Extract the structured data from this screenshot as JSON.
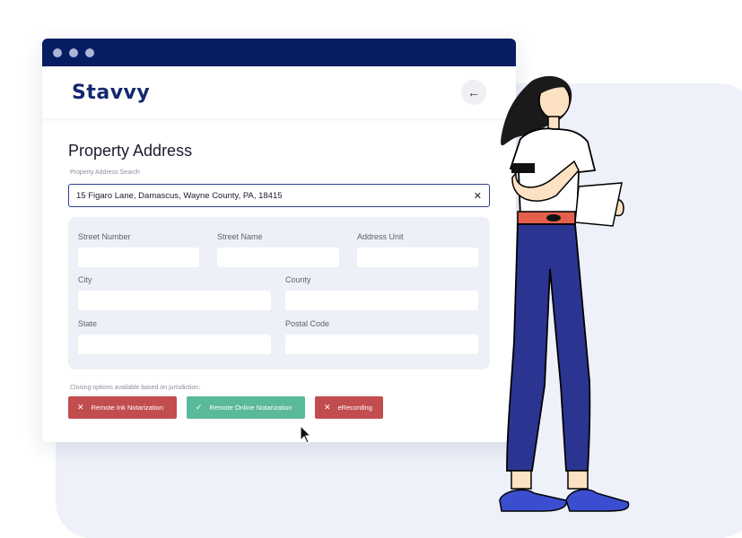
{
  "app": {
    "logo": "Stavvy"
  },
  "header": {
    "back_icon": "arrow-left-icon"
  },
  "page": {
    "title": "Property Address",
    "search_label": "Property Address Search",
    "search_value": "15 Figaro Lane, Damascus, Wayne County, PA, 18415",
    "clear_icon": "close-icon"
  },
  "form": {
    "street_number": "Street Number",
    "street_name": "Street Name",
    "address_unit": "Address Unit",
    "city": "City",
    "county": "County",
    "state": "State",
    "postal_code": "Postal Code"
  },
  "closing": {
    "label": "Closing options available based on jurisdiction:",
    "options": [
      {
        "label": "Remote Ink Notarization",
        "icon": "close-icon",
        "color": "#c24d4f"
      },
      {
        "label": "Remote Online Notarization",
        "icon": "check-icon",
        "color": "#5bb99b"
      },
      {
        "label": "eRecording",
        "icon": "close-icon",
        "color": "#c24d4f"
      }
    ]
  },
  "colors": {
    "titlebar": "#061c63",
    "logo": "#14286e",
    "background_panel": "#eef1f9"
  }
}
